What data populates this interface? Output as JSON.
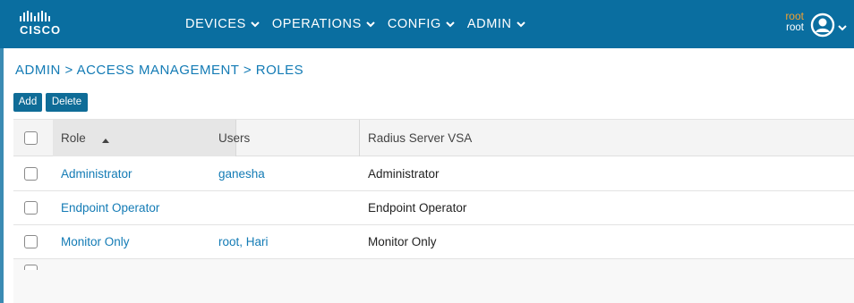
{
  "brand": {
    "logo_text": "CISCO",
    "logo_bar_heights": [
      6,
      10,
      12,
      10,
      6,
      10,
      12,
      10,
      6
    ]
  },
  "nav": [
    {
      "label": "DEVICES",
      "icon": "chevron-down-icon"
    },
    {
      "label": "OPERATIONS",
      "icon": "chevron-down-icon"
    },
    {
      "label": "CONFIG",
      "icon": "chevron-down-icon"
    },
    {
      "label": "ADMIN",
      "icon": "chevron-down-icon"
    }
  ],
  "user": {
    "name": "root",
    "role": "root",
    "avatar_icon": "user-avatar-icon"
  },
  "breadcrumb": "ADMIN > ACCESS MANAGEMENT > ROLES",
  "toolbar": {
    "add_label": "Add",
    "delete_label": "Delete"
  },
  "table": {
    "columns": [
      {
        "label": "Role",
        "sort": "ascending",
        "sort_icon": "sort-up-icon"
      },
      {
        "label": "Users"
      },
      {
        "label": "Radius Server VSA"
      }
    ],
    "rows": [
      {
        "role": "Administrator",
        "users": [
          "ganesha"
        ],
        "vsa": "Administrator"
      },
      {
        "role": "Endpoint Operator",
        "users": [],
        "vsa": "Endpoint Operator"
      },
      {
        "role": "Monitor Only",
        "users": [
          "root",
          "Hari"
        ],
        "vsa": "Monitor Only"
      }
    ],
    "user_separator": ", "
  },
  "colors": {
    "header_bg": "#0a6ea0",
    "link": "#137bb5",
    "button_bg": "#0f6c97",
    "username": "#f0a030"
  }
}
